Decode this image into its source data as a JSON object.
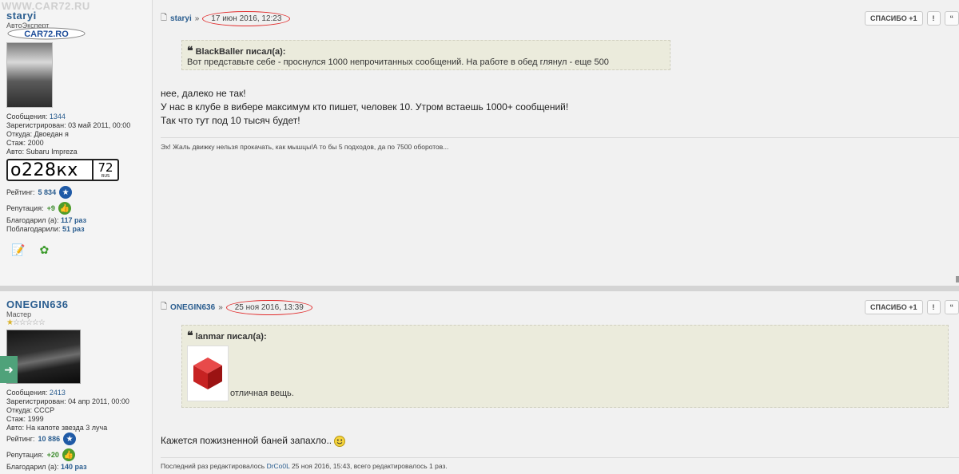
{
  "site": {
    "watermark": "WWW.CAR72.RU",
    "logo": "CAR72.RO"
  },
  "posts": [
    {
      "username": "staryi",
      "rank": "АвтоЭксперт",
      "info": [
        {
          "label": "Сообщения:",
          "value": "1344"
        },
        {
          "label": "Зарегистрирован:",
          "value": "03 май 2011, 00:00"
        },
        {
          "label": "Откуда:",
          "value": "Двоедан я"
        },
        {
          "label": "Стаж:",
          "value": "2000"
        },
        {
          "label": "Авто:",
          "value": "Subaru Impreza"
        }
      ],
      "plate": {
        "number": "о228кх",
        "region": "72",
        "country": "RUS"
      },
      "rating_label": "Рейтинг:",
      "rating": "5 834",
      "reputation_label": "Репутация:",
      "reputation": "+9",
      "thanked_label": "Благодарил (а):",
      "thanked": "117 раз",
      "thanked_by_label": "Поблагодарили:",
      "thanked_by": "51 раз",
      "author": "staryi",
      "arrow": "»",
      "date": "17 июн 2016, 12:23",
      "buttons": [
        "СПАСИБО +1",
        "!",
        "“"
      ],
      "quote_author": "BlackBaller писал(а):",
      "quote_text": "Вот представьте себе - проснулся 1000 непрочитанных сообщений. На работе в обед глянул - еще 500",
      "body": [
        "нее, далеко не так!",
        "У нас в клубе в вибере максимум кто пишет, человек 10. Утром встаешь 1000+ сообщений!",
        "Так что тут под 10 тысяч будет!"
      ],
      "signature": "Эх! Жаль движку нельзя прокачать, как мышцы!А то бы 5 подходов, да по 7500 оборотов..."
    },
    {
      "username": "ONEGIN636",
      "rank": "Мастер",
      "info": [
        {
          "label": "Сообщения:",
          "value": "2413"
        },
        {
          "label": "Зарегистрирован:",
          "value": "04 апр 2011, 00:00"
        },
        {
          "label": "Откуда:",
          "value": "СССР"
        },
        {
          "label": "Стаж:",
          "value": "1999"
        },
        {
          "label": "Авто:",
          "value": "На капоте звезда 3 луча"
        }
      ],
      "rating_label": "Рейтинг:",
      "rating": "10 886",
      "reputation_label": "Репутация:",
      "reputation": "+20",
      "thanked_label": "Благодарил (а):",
      "thanked": "140 раз",
      "author": "ONEGIN636",
      "arrow": "»",
      "date": "25 ноя 2016, 13:39",
      "buttons": [
        "СПАСИБО +1",
        "!",
        "“"
      ],
      "quote_author": "lanmar писал(а):",
      "quote_text": "отличная вещь.",
      "body": [
        "Кажется пожизненной баней запахло.."
      ],
      "edit_prefix": "Последний раз редактировалось",
      "edit_user": "DrCo0L",
      "edit_suffix": "25 ноя 2016, 15:43, всего редактировалось 1 раз."
    }
  ]
}
